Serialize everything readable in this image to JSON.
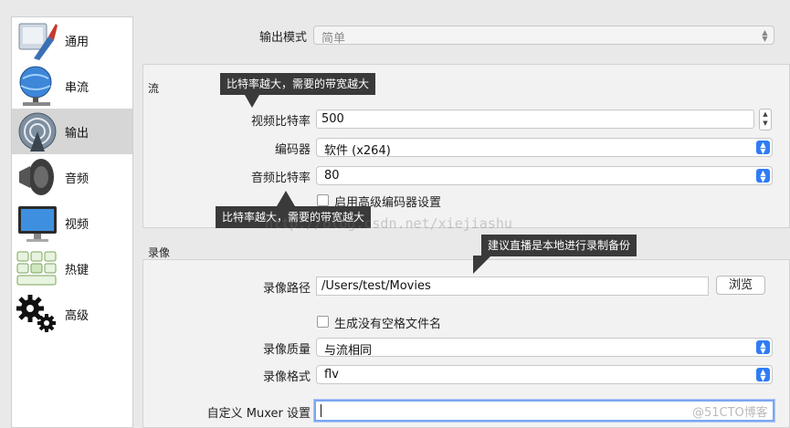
{
  "sidebar": {
    "items": [
      {
        "label": "通用",
        "icon": "general-icon"
      },
      {
        "label": "串流",
        "icon": "stream-icon"
      },
      {
        "label": "输出",
        "icon": "output-icon"
      },
      {
        "label": "音频",
        "icon": "audio-icon"
      },
      {
        "label": "视频",
        "icon": "video-icon"
      },
      {
        "label": "热键",
        "icon": "hotkeys-icon"
      },
      {
        "label": "高级",
        "icon": "advanced-icon"
      }
    ],
    "active": "输出"
  },
  "output_mode": {
    "label": "输出模式",
    "value": "简单"
  },
  "stream": {
    "title": "流",
    "video_bitrate": {
      "label": "视频比特率",
      "value": "500"
    },
    "encoder": {
      "label": "编码器",
      "value": "软件 (x264)"
    },
    "audio_bitrate": {
      "label": "音频比特率",
      "value": "80"
    },
    "advanced_encoder": {
      "label": "启用高级编码器设置"
    }
  },
  "recording": {
    "title": "录像",
    "path": {
      "label": "录像路径",
      "value": "/Users/test/Movies"
    },
    "browse_label": "浏览",
    "no_space": {
      "label": "生成没有空格文件名"
    },
    "quality": {
      "label": "录像质量",
      "value": "与流相同"
    },
    "format": {
      "label": "录像格式",
      "value": "flv"
    },
    "muxer": {
      "label": "自定义 Muxer 设置",
      "value": ""
    }
  },
  "annotations": {
    "tip1": "比特率越大，需要的带宽越大",
    "tip2": "比特率越大，需要的带宽越大",
    "tip3": "建议直播是本地进行录制备份"
  },
  "watermarks": {
    "url": "http://blog.csdn.net/xiejiashu",
    "brand": "@51CTO博客"
  },
  "colors": {
    "accent": "#2f7cf6",
    "tooltip": "#3a3a3a"
  }
}
